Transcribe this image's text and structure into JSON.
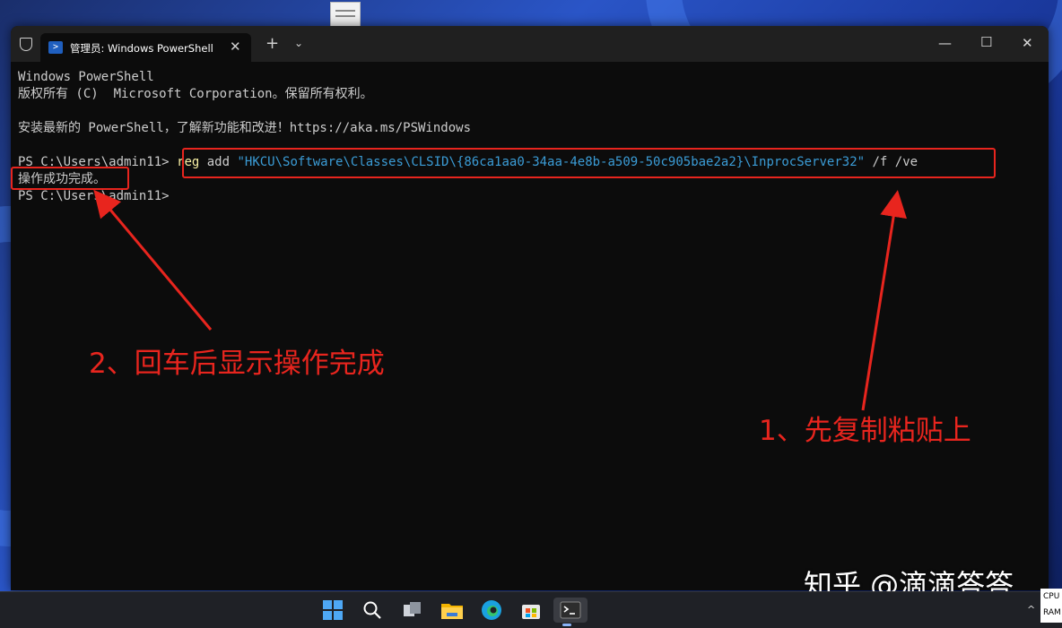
{
  "window": {
    "tab_title": "管理员: Windows PowerShell"
  },
  "terminal": {
    "lines": [
      "Windows PowerShell",
      "版权所有 (C)  Microsoft Corporation。保留所有权利。",
      "",
      "安装最新的 PowerShell，了解新功能和改进！https://aka.ms/PSWindows",
      ""
    ],
    "prompt": "PS C:\\Users\\admin11> ",
    "command_keyword": "reg",
    "command_sub": " add ",
    "command_string": "\"HKCU\\Software\\Classes\\CLSID\\{86ca1aa0-34aa-4e8b-a509-50c905bae2a2}\\InprocServer32\"",
    "command_args": " /f /ve",
    "result": "操作成功完成。",
    "prompt2": "PS C:\\Users\\admin11>"
  },
  "annotations": {
    "step1": "1、先复制粘贴上",
    "step2": "2、回车后显示操作完成",
    "color": "#e8251e"
  },
  "watermark": "知乎 @滴滴答答",
  "taskbar": {
    "icons": [
      "windows-start-icon",
      "search-icon",
      "task-view-icon",
      "file-explorer-icon",
      "edge-icon",
      "store-icon",
      "terminal-icon"
    ],
    "tray_cpu": "CPU",
    "tray_ram": "RAM"
  }
}
